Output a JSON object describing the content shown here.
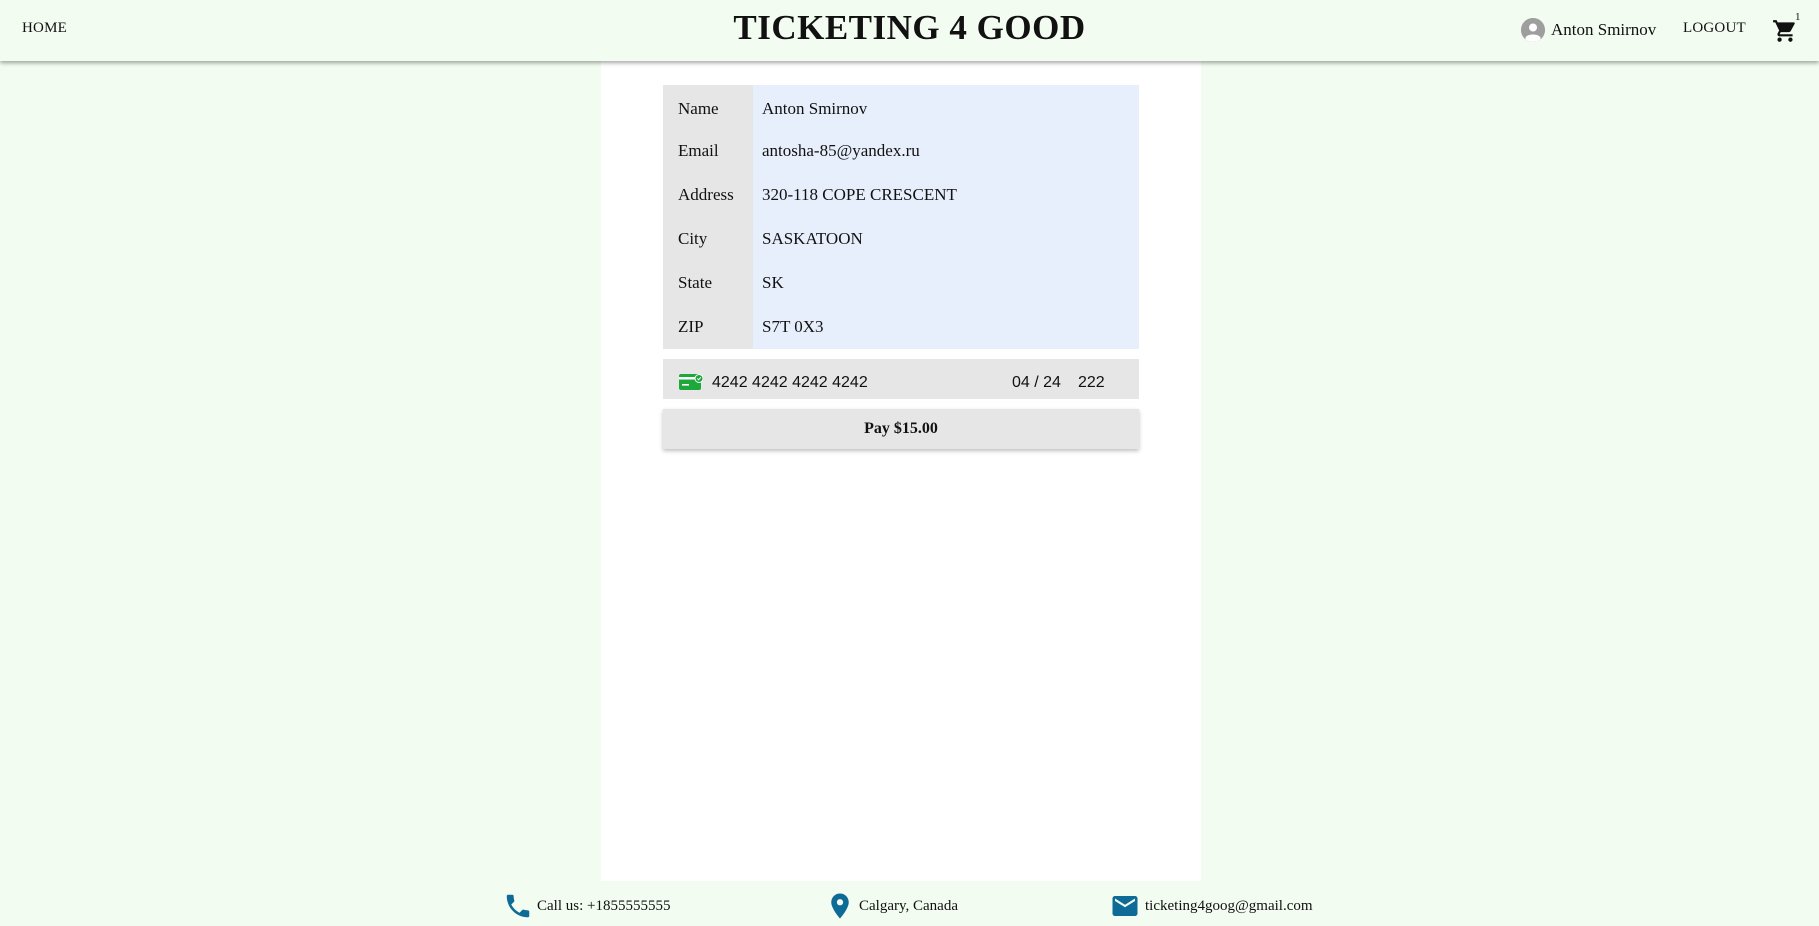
{
  "header": {
    "home_label": "HOME",
    "title": "TICKETING 4 GOOD",
    "user_name": "Anton Smirnov",
    "logout_label": "LOGOUT",
    "cart_count": "1",
    "icons": {
      "avatar": "account-circle-icon",
      "cart": "shopping-cart-icon"
    }
  },
  "billing": {
    "rows": [
      {
        "label": "Name",
        "value": "Anton Smirnov"
      },
      {
        "label": "Email",
        "value": "antosha-85@yandex.ru"
      },
      {
        "label": "Address",
        "value": "320-118 COPE CRESCENT"
      },
      {
        "label": "City",
        "value": "SASKATOON"
      },
      {
        "label": "State",
        "value": "SK"
      },
      {
        "label": "ZIP",
        "value": "S7T 0X3"
      }
    ]
  },
  "card": {
    "number": "4242 4242 4242 4242",
    "expiry": "04 / 24",
    "cvc": "222",
    "icon": "credit-card-icon",
    "icon_color": "#1ea83c"
  },
  "pay_button_label": "Pay $15.00",
  "footer": {
    "phone": "Call us: +1855555555",
    "location": "Calgary, Canada",
    "email": "ticketing4goog@gmail.com",
    "icon_color": "#0e6a96",
    "icons": {
      "phone": "phone-icon",
      "location": "location-pin-icon",
      "email": "mail-icon"
    }
  },
  "colors": {
    "page_background": "#f2fcf0",
    "panel_background": "#ffffff",
    "label_background": "#e6e6e6",
    "value_background": "#e8effc"
  }
}
